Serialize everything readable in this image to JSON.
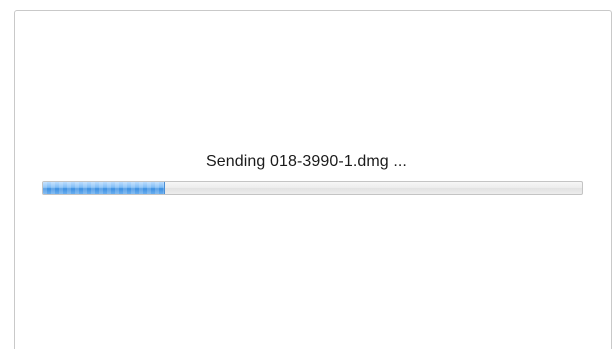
{
  "transfer": {
    "status_text": "Sending 018-3990-1.dmg ...",
    "progress_percent": 22.6
  },
  "colors": {
    "progress_fill": "#4a9bea",
    "panel_border": "#c9c9c9",
    "text": "#1a1a1a"
  }
}
